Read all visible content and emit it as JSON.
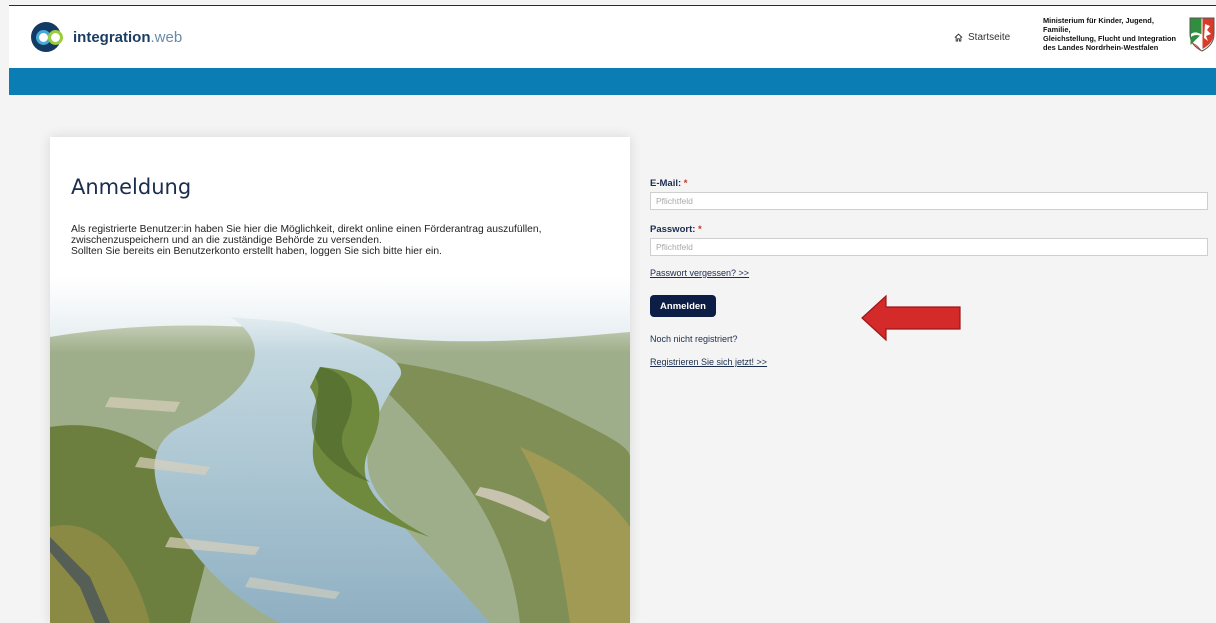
{
  "header": {
    "logo_bold": "integration",
    "logo_light": ".web",
    "home_label": "Startseite",
    "ministry_lines": [
      "Ministerium für Kinder, Jugend, Familie,",
      "Gleichstellung, Flucht und Integration",
      "des Landes Nordrhein-Westfalen"
    ]
  },
  "card": {
    "title": "Anmeldung",
    "description_lines": [
      "Als registrierte Benutzer:in haben Sie hier die Möglichkeit, direkt online einen Förderantrag auszufüllen,",
      "zwischenzuspeichern und an die zuständige Behörde zu versenden.",
      "Sollten Sie bereits ein Benutzerkonto erstellt haben, loggen Sie sich bitte hier ein."
    ]
  },
  "form": {
    "email_label": "E-Mail:",
    "email_placeholder": "Pflichtfeld",
    "password_label": "Passwort:",
    "password_placeholder": "Pflichtfeld",
    "required_marker": "*",
    "forgot_link": "Passwort vergessen? >>",
    "login_button": "Anmelden",
    "not_registered": "Noch nicht registriert?",
    "register_link": "Registrieren Sie sich jetzt! >>"
  },
  "colors": {
    "brand_blue": "#0a7eb4",
    "navy": "#0c1e46",
    "required_red": "#c0392b",
    "arrow_red": "#d42a2a"
  },
  "icons": {
    "home": "home-icon",
    "crest": "nrw-crest-icon",
    "arrow": "left-arrow-icon"
  }
}
